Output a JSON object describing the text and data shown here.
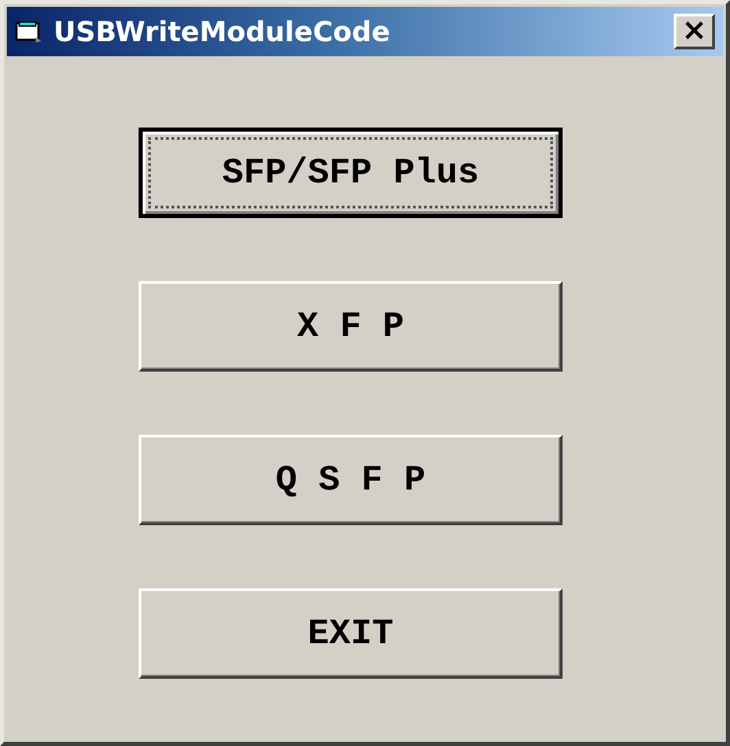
{
  "window": {
    "title": "USBWriteModuleCode",
    "close": "×"
  },
  "buttons": [
    {
      "label": "SFP/SFP Plus",
      "focused": true
    },
    {
      "label": "X F P",
      "focused": false
    },
    {
      "label": "Q S F P",
      "focused": false
    },
    {
      "label": "EXIT",
      "focused": false
    }
  ]
}
